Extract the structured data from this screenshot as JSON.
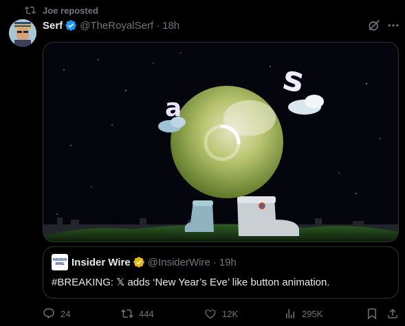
{
  "repost": {
    "text": "Joe reposted",
    "icon": "repost-icon"
  },
  "post": {
    "author_name": "Serf",
    "verified": "blue-verified-badge",
    "handle": "@TheRoyalSerf",
    "separator": "·",
    "time": "18h"
  },
  "media": {
    "type": "video-thumbnail",
    "description_icons": [
      "loading-spinner-icon"
    ],
    "colors": {
      "sky": "#05060d",
      "grass": "#1d3a1a",
      "egg": "#b9c46a"
    }
  },
  "quote": {
    "logo_line1": "INSIDER",
    "logo_line2": "WIRE",
    "author_name": "Insider Wire",
    "verified": "gold-verified-badge",
    "handle": "@InsiderWire",
    "separator": "·",
    "time": "19h",
    "text": "#BREAKING: 𝕏 adds ‘New Year’s Eve’ like button animation."
  },
  "actions": {
    "replies": "24",
    "reposts": "444",
    "likes": "12K",
    "views": "295K"
  },
  "colors": {
    "accent": "#1d9bf0",
    "gold": "#e2b719",
    "muted": "#71767b",
    "text": "#e7e9ea",
    "border": "#2f3336"
  }
}
